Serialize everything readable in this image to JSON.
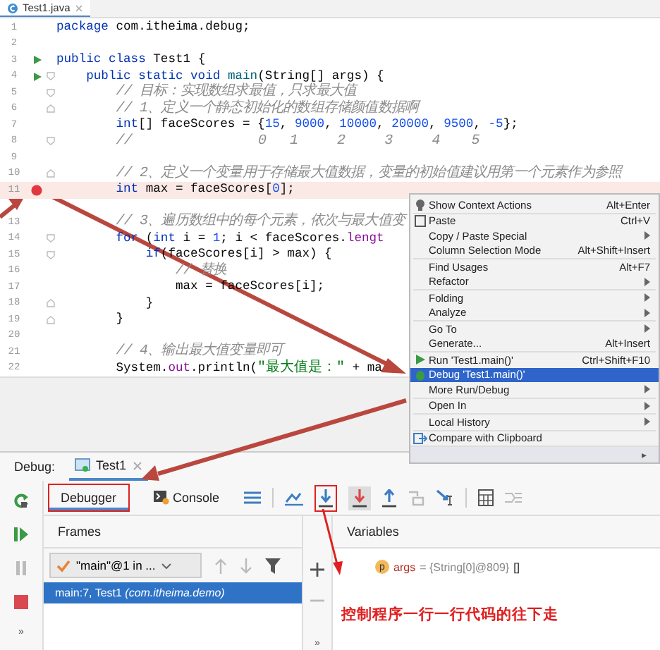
{
  "editor": {
    "file_tab": {
      "label": "Test1.java",
      "selected": true
    },
    "lines": [
      {
        "num": "1",
        "run": false,
        "breakpoint": false,
        "fold_start": false,
        "fold_end": false,
        "highlighted": false,
        "segs": [
          {
            "t": "package",
            "kind": "kw"
          },
          {
            "t": " com.itheima.debug;"
          }
        ]
      },
      {
        "num": "2",
        "run": false,
        "breakpoint": false,
        "fold_start": false,
        "fold_end": false,
        "highlighted": false
      },
      {
        "num": "3",
        "run": true,
        "breakpoint": false,
        "fold_start": false,
        "fold_end": false,
        "highlighted": false,
        "segs": [
          {
            "t": "public class",
            "kind": "kw"
          },
          {
            "t": " Test1 {"
          }
        ]
      },
      {
        "num": "4",
        "run": true,
        "breakpoint": false,
        "fold_start": true,
        "fold_end": false,
        "highlighted": false,
        "segs": [
          {
            "t": "    public static void",
            "kind": "kw"
          },
          {
            "t": " main",
            "kind": "method"
          },
          {
            "t": "(String[] args) {"
          }
        ]
      },
      {
        "num": "5",
        "run": false,
        "breakpoint": false,
        "fold_start": true,
        "fold_end": false,
        "highlighted": false,
        "segs": [
          {
            "t": "        // 目标：实现数组求最值，只求最大值",
            "kind": "comment"
          }
        ]
      },
      {
        "num": "6",
        "run": false,
        "breakpoint": false,
        "fold_start": false,
        "fold_end": true,
        "highlighted": false,
        "segs": [
          {
            "t": "        // 1、定义一个静态初始化的数组存储颜值数据啊",
            "kind": "comment"
          }
        ]
      },
      {
        "num": "7",
        "run": false,
        "breakpoint": false,
        "fold_start": false,
        "fold_end": false,
        "highlighted": false,
        "segs": [
          {
            "t": "        int",
            "kind": "kw"
          },
          {
            "t": "[] faceScores = {"
          },
          {
            "t": "15",
            "kind": "num"
          },
          {
            "t": ", "
          },
          {
            "t": "9000",
            "kind": "num"
          },
          {
            "t": ", "
          },
          {
            "t": "10000",
            "kind": "num"
          },
          {
            "t": ", "
          },
          {
            "t": "20000",
            "kind": "num"
          },
          {
            "t": ", "
          },
          {
            "t": "9500",
            "kind": "num"
          },
          {
            "t": ", "
          },
          {
            "t": "-5",
            "kind": "num"
          },
          {
            "t": "};"
          }
        ]
      },
      {
        "num": "8",
        "run": false,
        "breakpoint": false,
        "fold_start": true,
        "fold_end": false,
        "highlighted": false,
        "segs": [
          {
            "t": "        //                0   1     2     3     4    5",
            "kind": "comment"
          }
        ]
      },
      {
        "num": "9",
        "run": false,
        "breakpoint": false,
        "fold_start": false,
        "fold_end": false,
        "highlighted": false
      },
      {
        "num": "10",
        "run": false,
        "breakpoint": false,
        "fold_start": false,
        "fold_end": true,
        "highlighted": false,
        "segs": [
          {
            "t": "        // 2、定义一个变量用于存储最大值数据，变量的初始值建议用第一个元素作为参照",
            "kind": "comment"
          }
        ]
      },
      {
        "num": "11",
        "run": false,
        "breakpoint": true,
        "fold_start": false,
        "fold_end": false,
        "highlighted": true,
        "segs": [
          {
            "t": "        int",
            "kind": "kw"
          },
          {
            "t": " max = faceScores["
          },
          {
            "t": "0",
            "kind": "num"
          },
          {
            "t": "];"
          }
        ]
      },
      {
        "num": "13",
        "blank_before": true,
        "run": false,
        "breakpoint": false,
        "fold_start": false,
        "fold_end": false,
        "highlighted": false,
        "segs": [
          {
            "t": "        // 3、遍历数组中的每个元素，依次与最大值变",
            "kind": "comment"
          }
        ]
      },
      {
        "num": "14",
        "run": false,
        "breakpoint": false,
        "fold_start": true,
        "fold_end": false,
        "highlighted": false,
        "segs": [
          {
            "t": "        for",
            "kind": "kw"
          },
          {
            "t": " ("
          },
          {
            "t": "int",
            "kind": "kw"
          },
          {
            "t": " i = "
          },
          {
            "t": "1",
            "kind": "num"
          },
          {
            "t": "; i < faceScores."
          },
          {
            "t": "lengt",
            "kind": "field"
          }
        ]
      },
      {
        "num": "15",
        "run": false,
        "breakpoint": false,
        "fold_start": true,
        "fold_end": false,
        "highlighted": false,
        "segs": [
          {
            "t": "            if",
            "kind": "kw"
          },
          {
            "t": "(faceScores[i] > max) {"
          }
        ]
      },
      {
        "num": "16",
        "run": false,
        "breakpoint": false,
        "fold_start": false,
        "fold_end": false,
        "highlighted": false,
        "segs": [
          {
            "t": "                // 替换",
            "kind": "comment"
          }
        ]
      },
      {
        "num": "17",
        "run": false,
        "breakpoint": false,
        "fold_start": false,
        "fold_end": false,
        "highlighted": false,
        "segs": [
          {
            "t": "                max = faceScores[i];"
          }
        ]
      },
      {
        "num": "18",
        "run": false,
        "breakpoint": false,
        "fold_start": false,
        "fold_end": true,
        "highlighted": false,
        "segs": [
          {
            "t": "            }"
          }
        ]
      },
      {
        "num": "19",
        "run": false,
        "breakpoint": false,
        "fold_start": false,
        "fold_end": true,
        "highlighted": false,
        "segs": [
          {
            "t": "        }"
          }
        ]
      },
      {
        "num": "20",
        "run": false,
        "breakpoint": false,
        "fold_start": false,
        "fold_end": false,
        "highlighted": false
      },
      {
        "num": "21",
        "run": false,
        "breakpoint": false,
        "fold_start": false,
        "fold_end": false,
        "highlighted": false,
        "segs": [
          {
            "t": "        // 4、输出最大值变量即可",
            "kind": "comment"
          }
        ]
      },
      {
        "num": "22",
        "run": false,
        "breakpoint": false,
        "fold_start": false,
        "fold_end": false,
        "highlighted": false,
        "segs": [
          {
            "t": "        System."
          },
          {
            "t": "out",
            "kind": "field"
          },
          {
            "t": ".println("
          },
          {
            "t": "\"最大值是：\"",
            "kind": "str"
          },
          {
            "t": " + ma"
          }
        ]
      }
    ]
  },
  "context_menu": {
    "items": [
      {
        "label": "Show Context Actions",
        "shortcut": "Alt+Enter",
        "kind": "bulb",
        "submenu": false,
        "selected": false
      },
      {
        "label": "Paste",
        "shortcut": "Ctrl+V",
        "kind": "clipboard",
        "separator_before": true,
        "submenu": false,
        "selected": false
      },
      {
        "label": "Copy / Paste Special",
        "submenu": true,
        "selected": false
      },
      {
        "label": "Column Selection Mode",
        "shortcut": "Alt+Shift+Insert",
        "submenu": false,
        "selected": false
      },
      {
        "label": "Find Usages",
        "shortcut": "Alt+F7",
        "separator_before": true,
        "submenu": false,
        "selected": false
      },
      {
        "label": "Refactor",
        "submenu": true,
        "selected": false
      },
      {
        "label": "Folding",
        "separator_before": true,
        "submenu": true,
        "selected": false
      },
      {
        "label": "Analyze",
        "submenu": true,
        "selected": false
      },
      {
        "label": "Go To",
        "separator_before": true,
        "submenu": true,
        "selected": false
      },
      {
        "label": "Generate...",
        "shortcut": "Alt+Insert",
        "submenu": false,
        "selected": false
      },
      {
        "label": "Run 'Test1.main()'",
        "shortcut": "Ctrl+Shift+F10",
        "kind": "run",
        "separator_before": true,
        "submenu": false,
        "selected": false
      },
      {
        "label": "Debug 'Test1.main()'",
        "kind": "debug",
        "submenu": false,
        "selected": true
      },
      {
        "label": "More Run/Debug",
        "submenu": true,
        "selected": false
      },
      {
        "label": "Open In",
        "separator_before": true,
        "submenu": true,
        "selected": false
      },
      {
        "label": "Local History",
        "separator_before": true,
        "submenu": true,
        "selected": false
      },
      {
        "label": "Compare with Clipboard",
        "kind": "compare",
        "separator_before": true,
        "submenu": false,
        "selected": false
      }
    ],
    "extra_row": {
      "arrow": "▸"
    }
  },
  "debug_panel": {
    "title": "Debug:",
    "tab": {
      "label": "Test1",
      "selected": true
    },
    "tabs": [
      {
        "label": "Debugger",
        "selected": true,
        "annotated": true
      },
      {
        "label": "Console",
        "selected": false,
        "annotated": false
      }
    ],
    "step_over_annotated": true,
    "frames": {
      "header": "Frames",
      "thread": "\"main\"@1 in ...",
      "items": [
        {
          "method": "main:7, Test1",
          "package": "(com.itheima.demo)",
          "selected": true
        }
      ]
    },
    "variables": {
      "header": "Variables",
      "items": [
        {
          "badge": "p",
          "name": "args",
          "value": "= {String[0]@809}",
          "extra": "[]"
        }
      ]
    },
    "more": [
      "»",
      "»"
    ],
    "annotation": "控制程序一行一行代码的往下走"
  }
}
